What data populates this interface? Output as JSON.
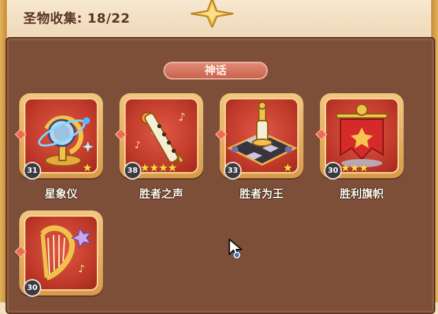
{
  "header": {
    "collection_label": "圣物收集: 18/22"
  },
  "tier": {
    "label": "神话"
  },
  "relics": [
    {
      "name": "星象仪",
      "level": "31",
      "stars": "★"
    },
    {
      "name": "胜者之声",
      "level": "38",
      "stars": "★★★★"
    },
    {
      "name": "胜者为王",
      "level": "33",
      "stars": "★"
    },
    {
      "name": "胜利旗帜",
      "level": "30",
      "stars": "★★★"
    },
    {
      "name": "",
      "level": "30",
      "stars": ""
    }
  ],
  "colors": {
    "panel": "#7d4e38",
    "card_inner": "#c23c2c",
    "card_frame": "#e0a95a",
    "star": "#ffd84a",
    "tier_badge": "#d8735e"
  }
}
